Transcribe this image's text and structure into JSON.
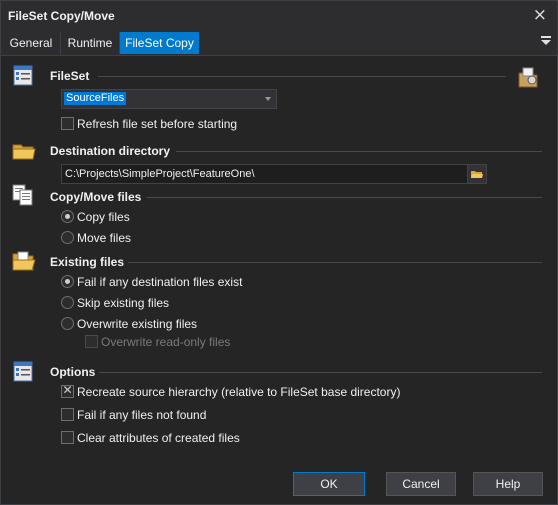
{
  "window": {
    "title": "FileSet Copy/Move",
    "close_icon": "×"
  },
  "tabs": [
    {
      "label": "General",
      "active": false
    },
    {
      "label": "Runtime",
      "active": false
    },
    {
      "label": "FileSet Copy",
      "active": true
    }
  ],
  "fileset": {
    "label": "FileSet",
    "selected": "SourceFiles",
    "refresh_label": "Refresh file set before starting",
    "refresh_checked": false
  },
  "destination": {
    "label": "Destination directory",
    "value": "C:\\Projects\\SimpleProject\\FeatureOne\\"
  },
  "copy_move": {
    "label": "Copy/Move files",
    "options": [
      "Copy files",
      "Move files"
    ],
    "selected": "Copy files"
  },
  "existing": {
    "label": "Existing files",
    "options": [
      "Fail if any destination files exist",
      "Skip existing files",
      "Overwrite existing files"
    ],
    "selected": "Fail if any destination files exist",
    "overwrite_readonly_label": "Overwrite read-only files",
    "overwrite_readonly_enabled": false
  },
  "options": {
    "label": "Options",
    "items": [
      {
        "label": "Recreate source hierarchy (relative to FileSet base directory)",
        "checked": true
      },
      {
        "label": "Fail if any files not found",
        "checked": false
      },
      {
        "label": "Clear attributes of created files",
        "checked": false
      }
    ]
  },
  "buttons": {
    "ok": "OK",
    "cancel": "Cancel",
    "help": "Help"
  },
  "colors": {
    "accent": "#007acc",
    "background": "#252526",
    "selection": "#0078d7"
  }
}
